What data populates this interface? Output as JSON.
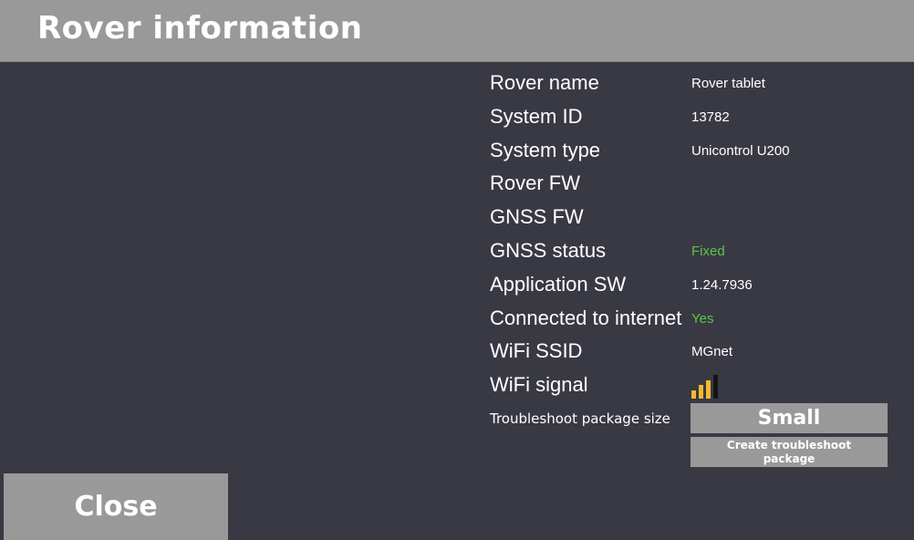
{
  "header": {
    "title": "Rover information"
  },
  "info_rows": [
    {
      "label": "Rover name",
      "value": "Rover tablet"
    },
    {
      "label": "System ID",
      "value": "13782"
    },
    {
      "label": "System type",
      "value": "Unicontrol U200"
    },
    {
      "label": "Rover FW",
      "value": ""
    },
    {
      "label": "GNSS FW",
      "value": ""
    },
    {
      "label": "GNSS status",
      "value": "Fixed"
    },
    {
      "label": "Application SW",
      "value": "1.24.7936"
    },
    {
      "label": "Connected to internet",
      "value": "Yes"
    },
    {
      "label": "WiFi SSID",
      "value": "MGnet"
    },
    {
      "label": "WiFi signal",
      "signal_bars_active": 3,
      "signal_bars_total": 4
    }
  ],
  "troubleshoot": {
    "label": "Troubleshoot package size",
    "size_button": "Small",
    "create_button": "Create troubleshoot package"
  },
  "close_button": "Close",
  "colors": {
    "background": "#393944",
    "header_bar": "#999999",
    "button": "#999999",
    "status_ok": "#5cc644",
    "signal_active": "#f5b82e",
    "signal_inactive": "#151515"
  }
}
